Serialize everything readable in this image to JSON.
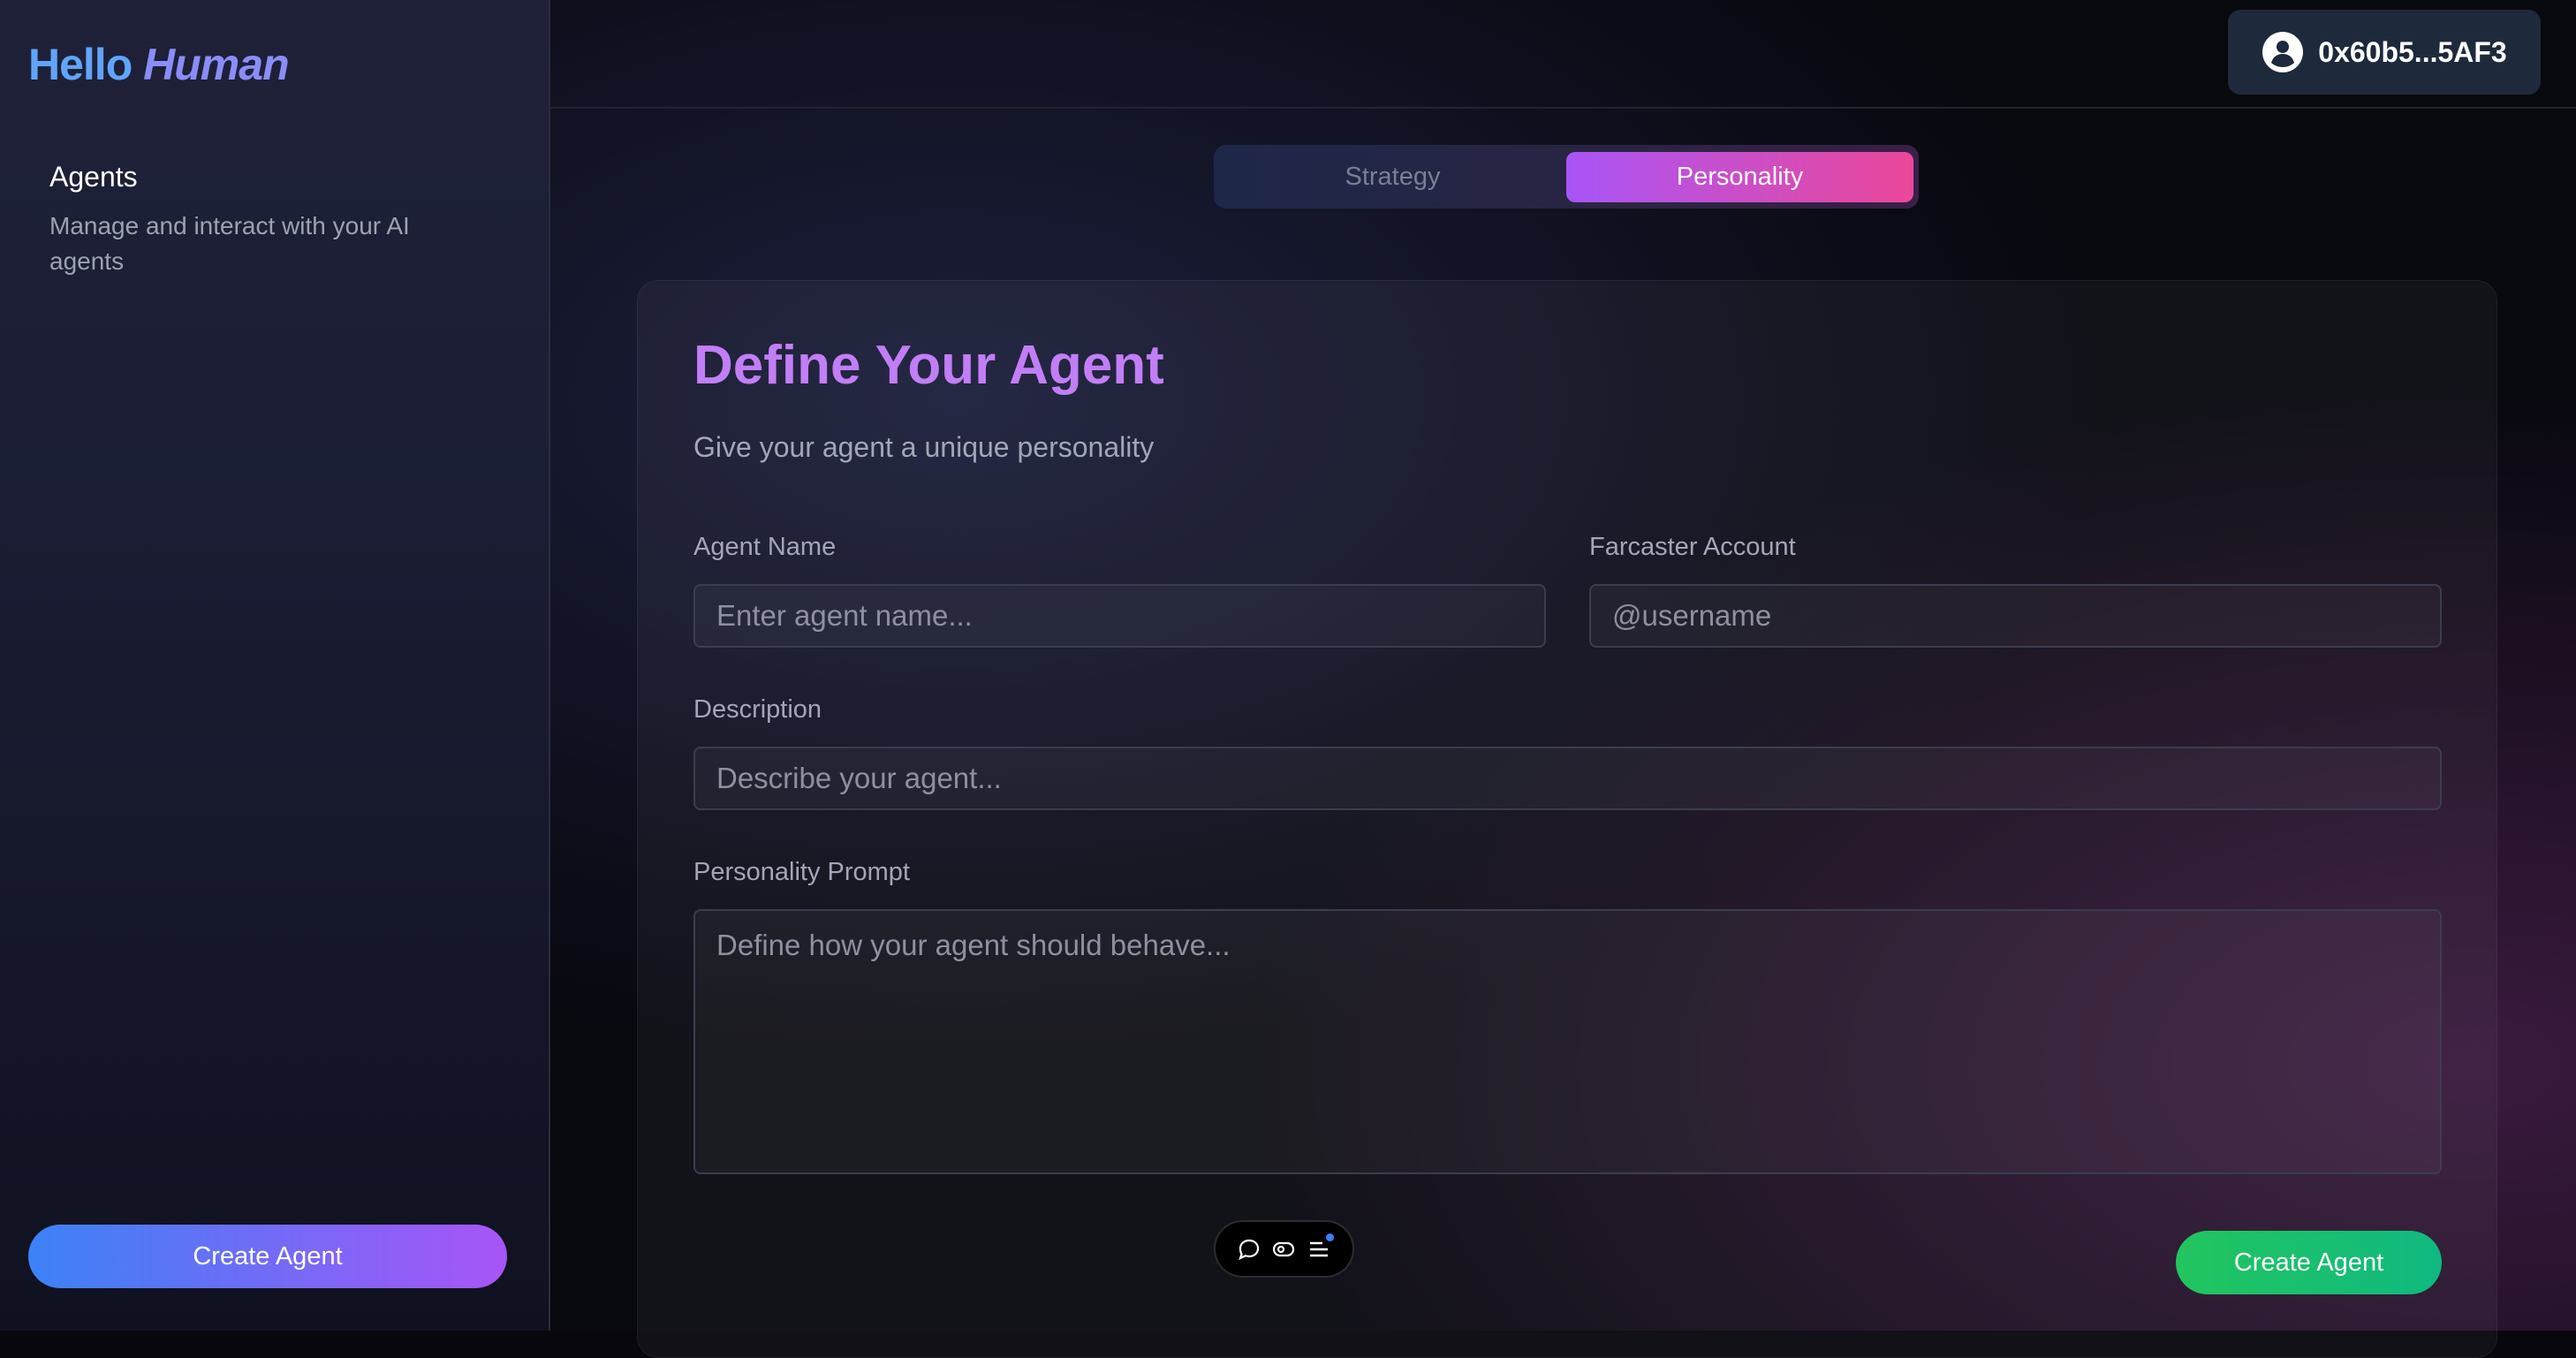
{
  "sidebar": {
    "logo": {
      "hello": "Hello",
      "human": "Human"
    },
    "nav": {
      "title": "Agents",
      "description": "Manage and interact with your AI agents"
    },
    "create_button": "Create Agent"
  },
  "header": {
    "wallet_address": "0x60b5...5AF3",
    "wallet_icon": "user-circle-icon"
  },
  "tabs": [
    {
      "label": "Strategy",
      "active": false
    },
    {
      "label": "Personality",
      "active": true
    }
  ],
  "form": {
    "title": "Define Your Agent",
    "subtitle": "Give your agent a unique personality",
    "agent_name": {
      "label": "Agent Name",
      "placeholder": "Enter agent name...",
      "value": ""
    },
    "farcaster": {
      "label": "Farcaster Account",
      "placeholder": "@username",
      "value": ""
    },
    "description": {
      "label": "Description",
      "placeholder": "Describe your agent...",
      "value": ""
    },
    "personality": {
      "label": "Personality Prompt",
      "placeholder": "Define how your agent should behave...",
      "value": ""
    },
    "submit": "Create Agent"
  },
  "toolbar": {
    "icons": [
      "chat-bubble-icon",
      "toggle-icon",
      "menu-icon"
    ]
  },
  "colors": {
    "accent_blue": "#3b82f6",
    "accent_purple": "#a855f7",
    "accent_pink": "#ec4899",
    "accent_green": "#22c55e"
  }
}
